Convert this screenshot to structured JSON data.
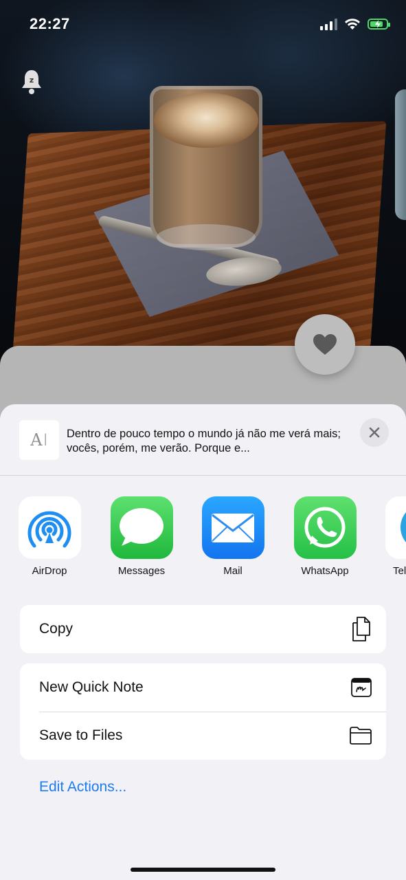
{
  "status_bar": {
    "time": "22:27",
    "signal_bars": 3,
    "battery_charging": true,
    "battery_level": 0.8
  },
  "background": {
    "snooze_icon": "bell-z-icon",
    "favorite_icon": "heart-icon"
  },
  "share_sheet": {
    "preview": {
      "thumbnail_icon": "text-cursor-icon",
      "thumbnail_glyph": "AI",
      "text": "Dentro de pouco tempo o mundo já não me verá mais; vocês, porém, me verão. Porque e..."
    },
    "close_icon": "close-icon",
    "apps": [
      {
        "label": "AirDrop",
        "icon": "airdrop-icon",
        "color": "#1f8ef1"
      },
      {
        "label": "Messages",
        "icon": "messages-icon",
        "color": "#34c759"
      },
      {
        "label": "Mail",
        "icon": "mail-icon",
        "color": "#1a8df5"
      },
      {
        "label": "WhatsApp",
        "icon": "whatsapp-icon",
        "color": "#2ecb59"
      },
      {
        "label": "Tel",
        "icon": "telegram-icon",
        "color": "#2aa3e0"
      }
    ],
    "actions_group_1": [
      {
        "label": "Copy",
        "icon": "copy-icon"
      }
    ],
    "actions_group_2": [
      {
        "label": "New Quick Note",
        "icon": "quick-note-icon"
      },
      {
        "label": "Save to Files",
        "icon": "folder-icon"
      }
    ],
    "edit_actions_label": "Edit Actions..."
  }
}
